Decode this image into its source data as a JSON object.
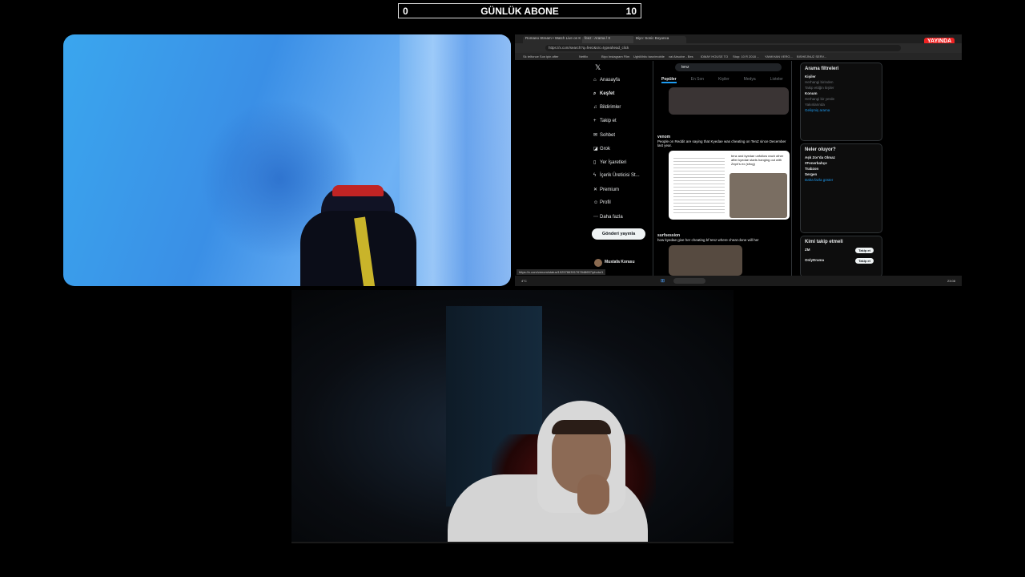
{
  "overlay": {
    "left_count": "0",
    "title": "GÜNLÜK ABONE",
    "right_count": "10"
  },
  "screen": {
    "live_badge": "YAYINDA",
    "tabs": [
      "Romano Stream • Watch Live on K",
      "feez - Arama / X",
      "Biyo: Sonic Boyunca"
    ],
    "url": "https://x.com/search?q=feez&src=typeahead_click",
    "bookmarks": [
      "Sk telfonce Son ipin after",
      "Netflix",
      "Biyo Instagram Film",
      "Ughili/hitc tanz/mobile",
      "vai Absolve - Bes",
      "IDMAY HOUSE TO",
      "Stop: 10 R 2018 ...",
      "YANKHAN VERG...",
      "BISHEJNUZ SERV..."
    ],
    "nav": [
      "Anasayfa",
      "Keşfet",
      "Bildirimler",
      "Takip et",
      "Sohbet",
      "Grok",
      "Yer İşaretleri",
      "İçerik Üreticisi St...",
      "Premium",
      "Profil",
      "Daha fazla"
    ],
    "post_button": "Gönderi yayınla",
    "profile_name": "Mustafa Korasu",
    "search_text": "tenz",
    "feed_tabs": [
      "Popüler",
      "En Son",
      "Kişiler",
      "Medya",
      "Listeler"
    ],
    "tweet1_user": "venom",
    "tweet1_text": "People on Reddit are saying that Kyedae was cheating on TenZ since December last year.",
    "card_text": "tenz and kyedae unfollow each other after kyedae starts hanging out with Zeph's ex (sfrog)",
    "tweet2_user": "surfsession",
    "tweet2_text": "how kyedae give her cheating bf tenz where cheat done will her",
    "filters_title": "Arama filtreleri",
    "filters_people": "Kişiler",
    "filters_opt1": "Herhangi birinden",
    "filters_opt2": "Takip ettiğin kişiler",
    "filters_location": "Konum",
    "filters_opt3": "Herhangi bir yerde",
    "filters_opt4": "Yakınlarında",
    "filters_link": "Gelişmiş arama",
    "trends_title": "Neler oluyor?",
    "trends": [
      "Aşk Zor'da Olmaz",
      "#Fenerbahçe",
      "Trabzon",
      "Sergen"
    ],
    "trends_more": "Daha fazla göster",
    "wtf_title": "Kimi takip etmeli",
    "wtf": [
      "ZM",
      "OnlyDrama"
    ],
    "follow_label": "Takip et",
    "status_url": "https://x.com/venom/status/1925786391767848657/photo/1",
    "weather": "4°C",
    "clock": "23:08"
  }
}
